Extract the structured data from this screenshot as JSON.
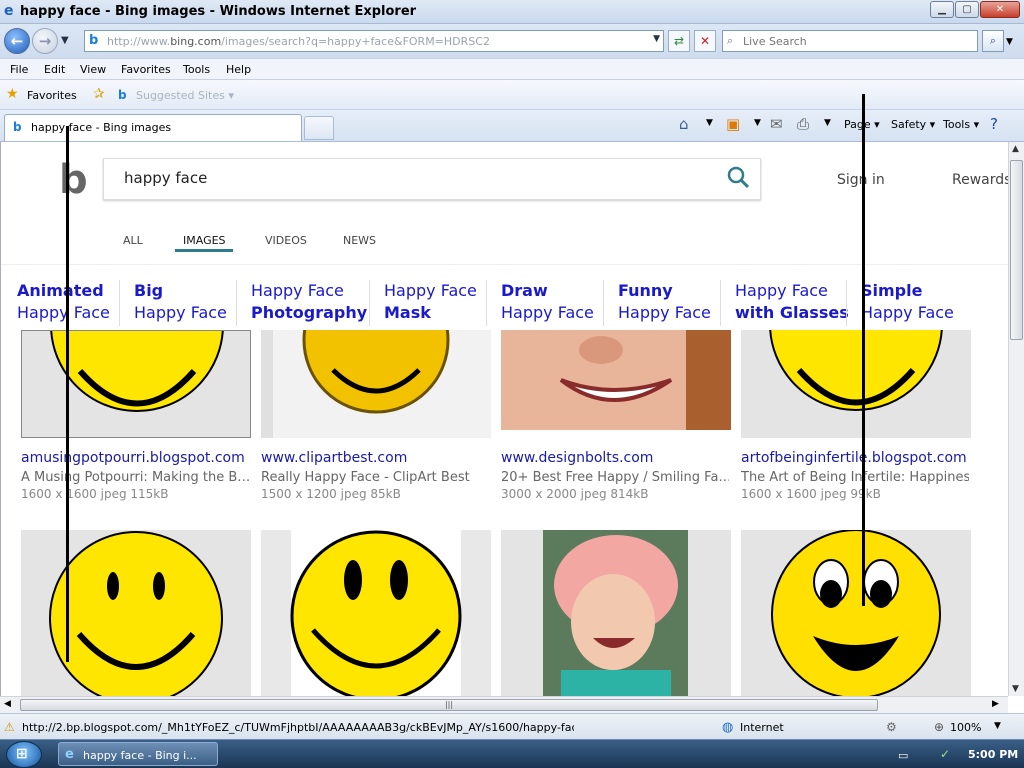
{
  "window": {
    "title": "happy face - Bing images - Windows Internet Explorer",
    "min_label": "▁",
    "max_label": "▢",
    "close_label": "✕"
  },
  "address": {
    "url_prefix": "http://www.",
    "url_domain": "bing.com",
    "url_path": "/images/search?q=happy+face&FORM=HDRSC2"
  },
  "search_box": {
    "placeholder": "Live Search"
  },
  "menubar": {
    "items": [
      "File",
      "Edit",
      "View",
      "Favorites",
      "Tools",
      "Help"
    ]
  },
  "favorites_bar": {
    "favorites": "Favorites",
    "suggested": "Suggested Sites ▾"
  },
  "tab": {
    "active_label": "happy face - Bing images"
  },
  "command_bar": {
    "page": "Page ▾",
    "safety": "Safety ▾",
    "tools": "Tools ▾"
  },
  "bing": {
    "query": "happy face",
    "sign_in": "Sign in",
    "rewards": "Rewards",
    "scopes": [
      "ALL",
      "IMAGES",
      "VIDEOS",
      "NEWS"
    ],
    "chips": [
      {
        "bold": "Animated",
        "reg": "Happy Face",
        "bold_first": true
      },
      {
        "bold": "Big",
        "reg": "Happy Face",
        "bold_first": true
      },
      {
        "bold": "Photography",
        "reg": "Happy Face",
        "bold_first": false
      },
      {
        "bold": "Mask",
        "reg": "Happy Face",
        "bold_first": false
      },
      {
        "bold": "Draw",
        "reg": "Happy Face",
        "bold_first": true
      },
      {
        "bold": "Funny",
        "reg": "Happy Face",
        "bold_first": true
      },
      {
        "bold": "with Glasses",
        "reg": "Happy Face",
        "bold_first": false
      },
      {
        "bold": "Simple",
        "reg": "Happy Face",
        "bold_first": true
      }
    ],
    "results": [
      {
        "site": "amusingpotpourri.blogspot.com",
        "title": "A Musing Potpourri: Making the B…",
        "meta": "1600 x 1600 jpeg 115kB"
      },
      {
        "site": "www.clipartbest.com",
        "title": "Really Happy Face - ClipArt Best",
        "meta": "1500 x 1200 jpeg 85kB"
      },
      {
        "site": "www.designbolts.com",
        "title": "20+ Best Free Happy / Smiling Fa…",
        "meta": "3000 x 2000 jpeg 814kB"
      },
      {
        "site": "artofbeinginfertile.blogspot.com",
        "title": "The Art of Being Infertile: Happiness",
        "meta": "1600 x 1600 jpeg 99kB"
      }
    ]
  },
  "status": {
    "url": "http://2.bp.blogspot.com/_Mh1tYFoEZ_c/TUWmFjhptbI/AAAAAAAAB3g/ckBEvJMp_AY/s1600/happy-face_hap",
    "zone": "Internet",
    "zoom": "100%"
  },
  "taskbar": {
    "ie_label": "happy face - Bing i...",
    "clock": "5:00 PM"
  },
  "colors": {
    "link_blue": "#1a1acc",
    "bing_teal": "#2e7c8e",
    "smiley_yellow": "#ffe600"
  }
}
